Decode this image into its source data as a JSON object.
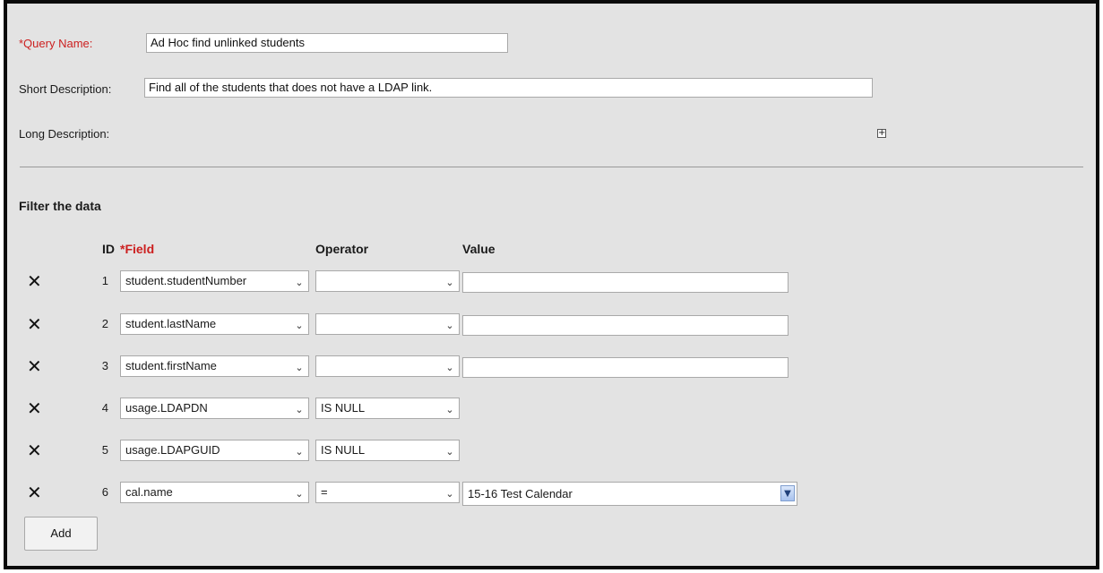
{
  "form": {
    "query_name_label": "*Query Name:",
    "query_name_value": "Ad Hoc find unlinked students",
    "short_desc_label": "Short Description:",
    "short_desc_value": "Find all of the students that does not have a LDAP link.",
    "long_desc_label": "Long Description:",
    "expand_icon": "plus-box-icon"
  },
  "filter": {
    "section_title": "Filter the data",
    "headers": {
      "id": "ID",
      "field": "*Field",
      "operator": "Operator",
      "value": "Value"
    },
    "rows": [
      {
        "id": "1",
        "field": "student.studentNumber",
        "operator": "",
        "value": ""
      },
      {
        "id": "2",
        "field": "student.lastName",
        "operator": "",
        "value": ""
      },
      {
        "id": "3",
        "field": "student.firstName",
        "operator": "",
        "value": ""
      },
      {
        "id": "4",
        "field": "usage.LDAPDN",
        "operator": "IS NULL"
      },
      {
        "id": "5",
        "field": "usage.LDAPGUID",
        "operator": "IS NULL"
      },
      {
        "id": "6",
        "field": "cal.name",
        "operator": "=",
        "value_select": "15-16 Test Calendar"
      }
    ],
    "delete_icon": "x-delete-icon",
    "add_label": "Add"
  },
  "colors": {
    "required": "#cc1f1f",
    "panel_bg": "#e3e3e3"
  }
}
